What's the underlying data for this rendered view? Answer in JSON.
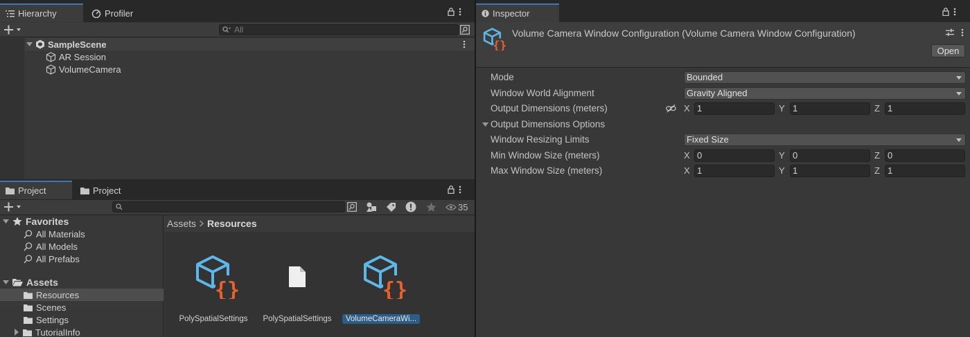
{
  "hierarchy": {
    "tabs": [
      {
        "label": "Hierarchy"
      },
      {
        "label": "Profiler"
      }
    ],
    "search_placeholder": "All",
    "scene": "SampleScene",
    "objects": [
      "AR Session",
      "VolumeCamera"
    ]
  },
  "project": {
    "tabs": [
      {
        "label": "Project"
      },
      {
        "label": "Project"
      }
    ],
    "visible_count": "35",
    "favorites": {
      "label": "Favorites",
      "items": [
        "All Materials",
        "All Models",
        "All Prefabs"
      ]
    },
    "assets": {
      "label": "Assets",
      "folders": [
        "Resources",
        "Scenes",
        "Settings",
        "TutorialInfo"
      ]
    },
    "breadcrumb": {
      "root": "Assets",
      "current": "Resources"
    },
    "files": [
      {
        "label": "PolySpatialSettings",
        "icon": "scriptable-object-icon"
      },
      {
        "label": "PolySpatialSettings",
        "icon": "file-icon"
      },
      {
        "label": "VolumeCameraWi...",
        "icon": "scriptable-object-icon"
      }
    ]
  },
  "inspector": {
    "tab": "Inspector",
    "title": "Volume Camera Window Configuration (Volume Camera Window Configuration)",
    "open_label": "Open",
    "mode": {
      "label": "Mode",
      "value": "Bounded"
    },
    "alignment": {
      "label": "Window World Alignment",
      "value": "Gravity Aligned"
    },
    "output_dims": {
      "label": "Output Dimensions (meters)",
      "x": "1",
      "y": "1",
      "z": "1"
    },
    "output_options": {
      "label": "Output Dimensions Options"
    },
    "resizing": {
      "label": "Window Resizing Limits",
      "value": "Fixed Size"
    },
    "min_size": {
      "label": "Min Window Size (meters)",
      "x": "0",
      "y": "0",
      "z": "0"
    },
    "max_size": {
      "label": "Max Window Size (meters)",
      "x": "1",
      "y": "1",
      "z": "1"
    },
    "axis": {
      "x": "X",
      "y": "Y",
      "z": "Z"
    }
  },
  "colors": {
    "accent": "#3a79bb",
    "selection": "#2c5d87",
    "brace": "#e8612c",
    "cube": "#5cb8e8"
  }
}
